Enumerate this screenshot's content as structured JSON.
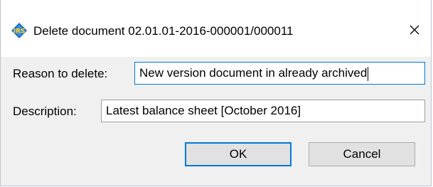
{
  "window": {
    "title": "Delete document 02.01.01-2016-000001/000011",
    "app_icon": "irms-app-icon",
    "close_icon": "close-icon"
  },
  "form": {
    "reason_label": "Reason to delete:",
    "reason_value": "New version document in already archived",
    "description_label": "Description:",
    "description_value": "Latest balance sheet [October 2016]"
  },
  "buttons": {
    "ok_label": "OK",
    "cancel_label": "Cancel"
  },
  "colors": {
    "accent": "#0078d7",
    "dialog_background": "#f0f0f0",
    "button_background": "#e1e1e1"
  }
}
